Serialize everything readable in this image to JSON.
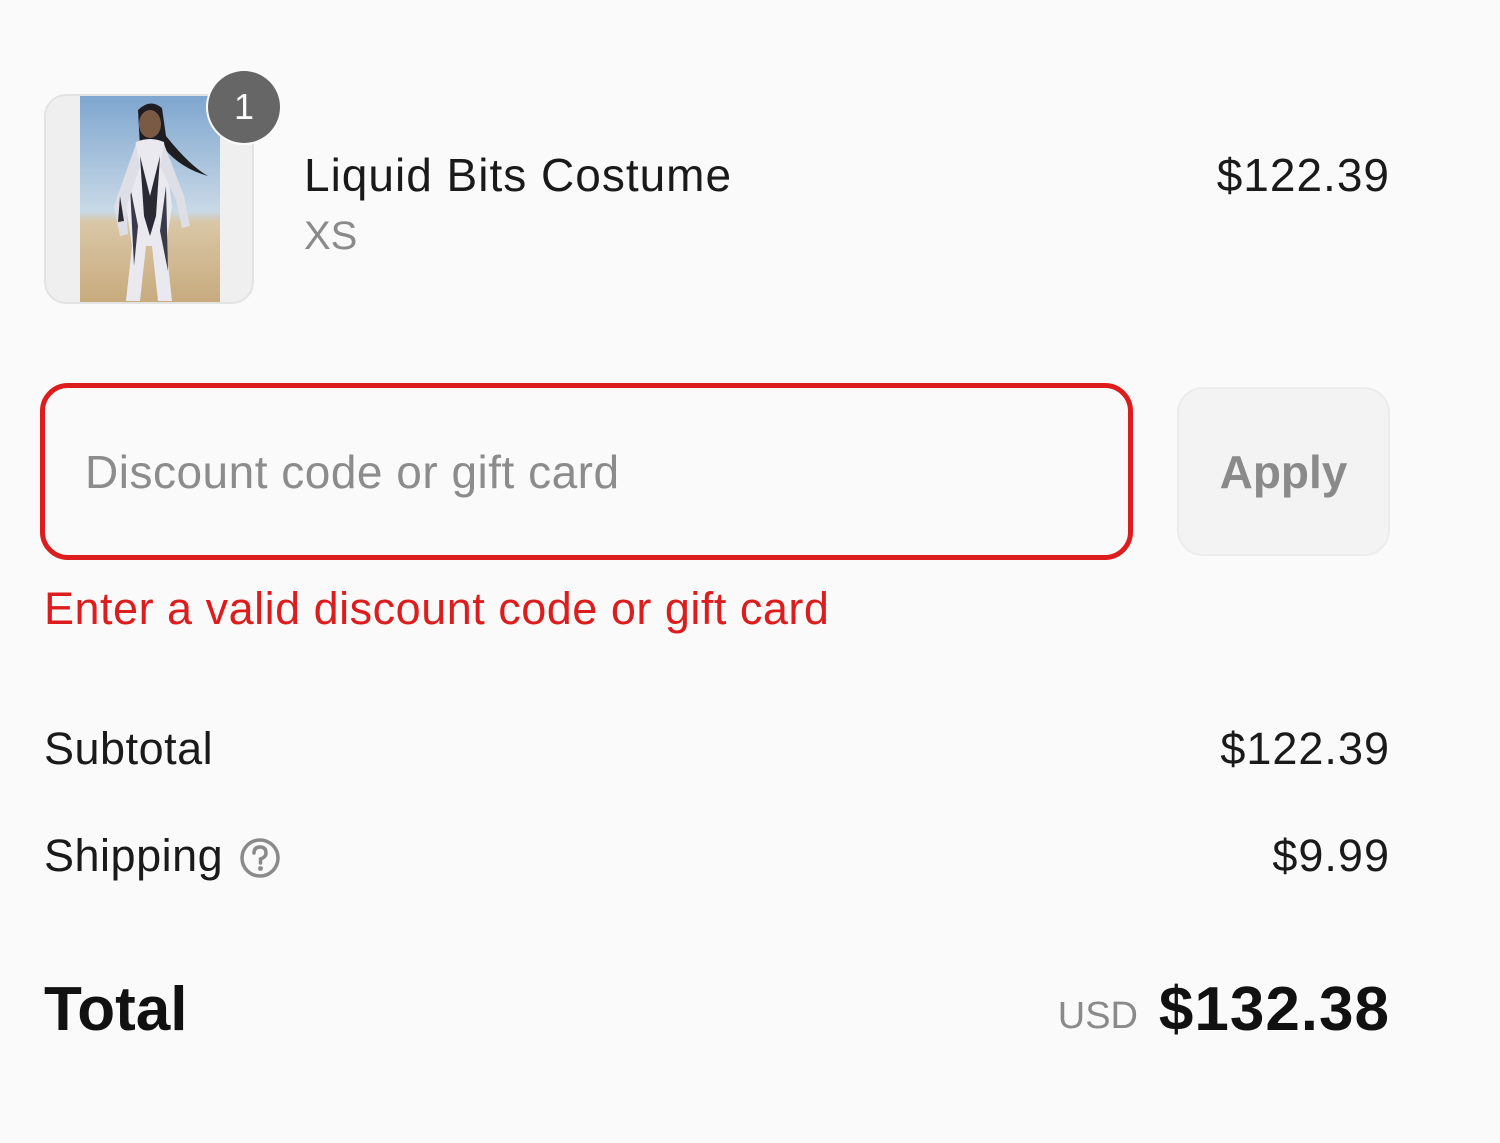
{
  "line_item": {
    "quantity": "1",
    "title": "Liquid Bits Costume",
    "variant": "XS",
    "price": "$122.39",
    "image_icon": "product-photo"
  },
  "discount": {
    "placeholder": "Discount code or gift card",
    "value": "",
    "apply_label": "Apply",
    "error": "Enter a valid discount code or gift card"
  },
  "summary": {
    "subtotal_label": "Subtotal",
    "subtotal_value": "$122.39",
    "shipping_label": "Shipping",
    "shipping_value": "$9.99",
    "shipping_help_icon": "question-circle-icon",
    "total_label": "Total",
    "currency": "USD",
    "total_value": "$132.38"
  },
  "colors": {
    "error": "#dd1d1d",
    "badge": "#666666",
    "muted": "#8a8a8a",
    "background": "#fafafa"
  }
}
